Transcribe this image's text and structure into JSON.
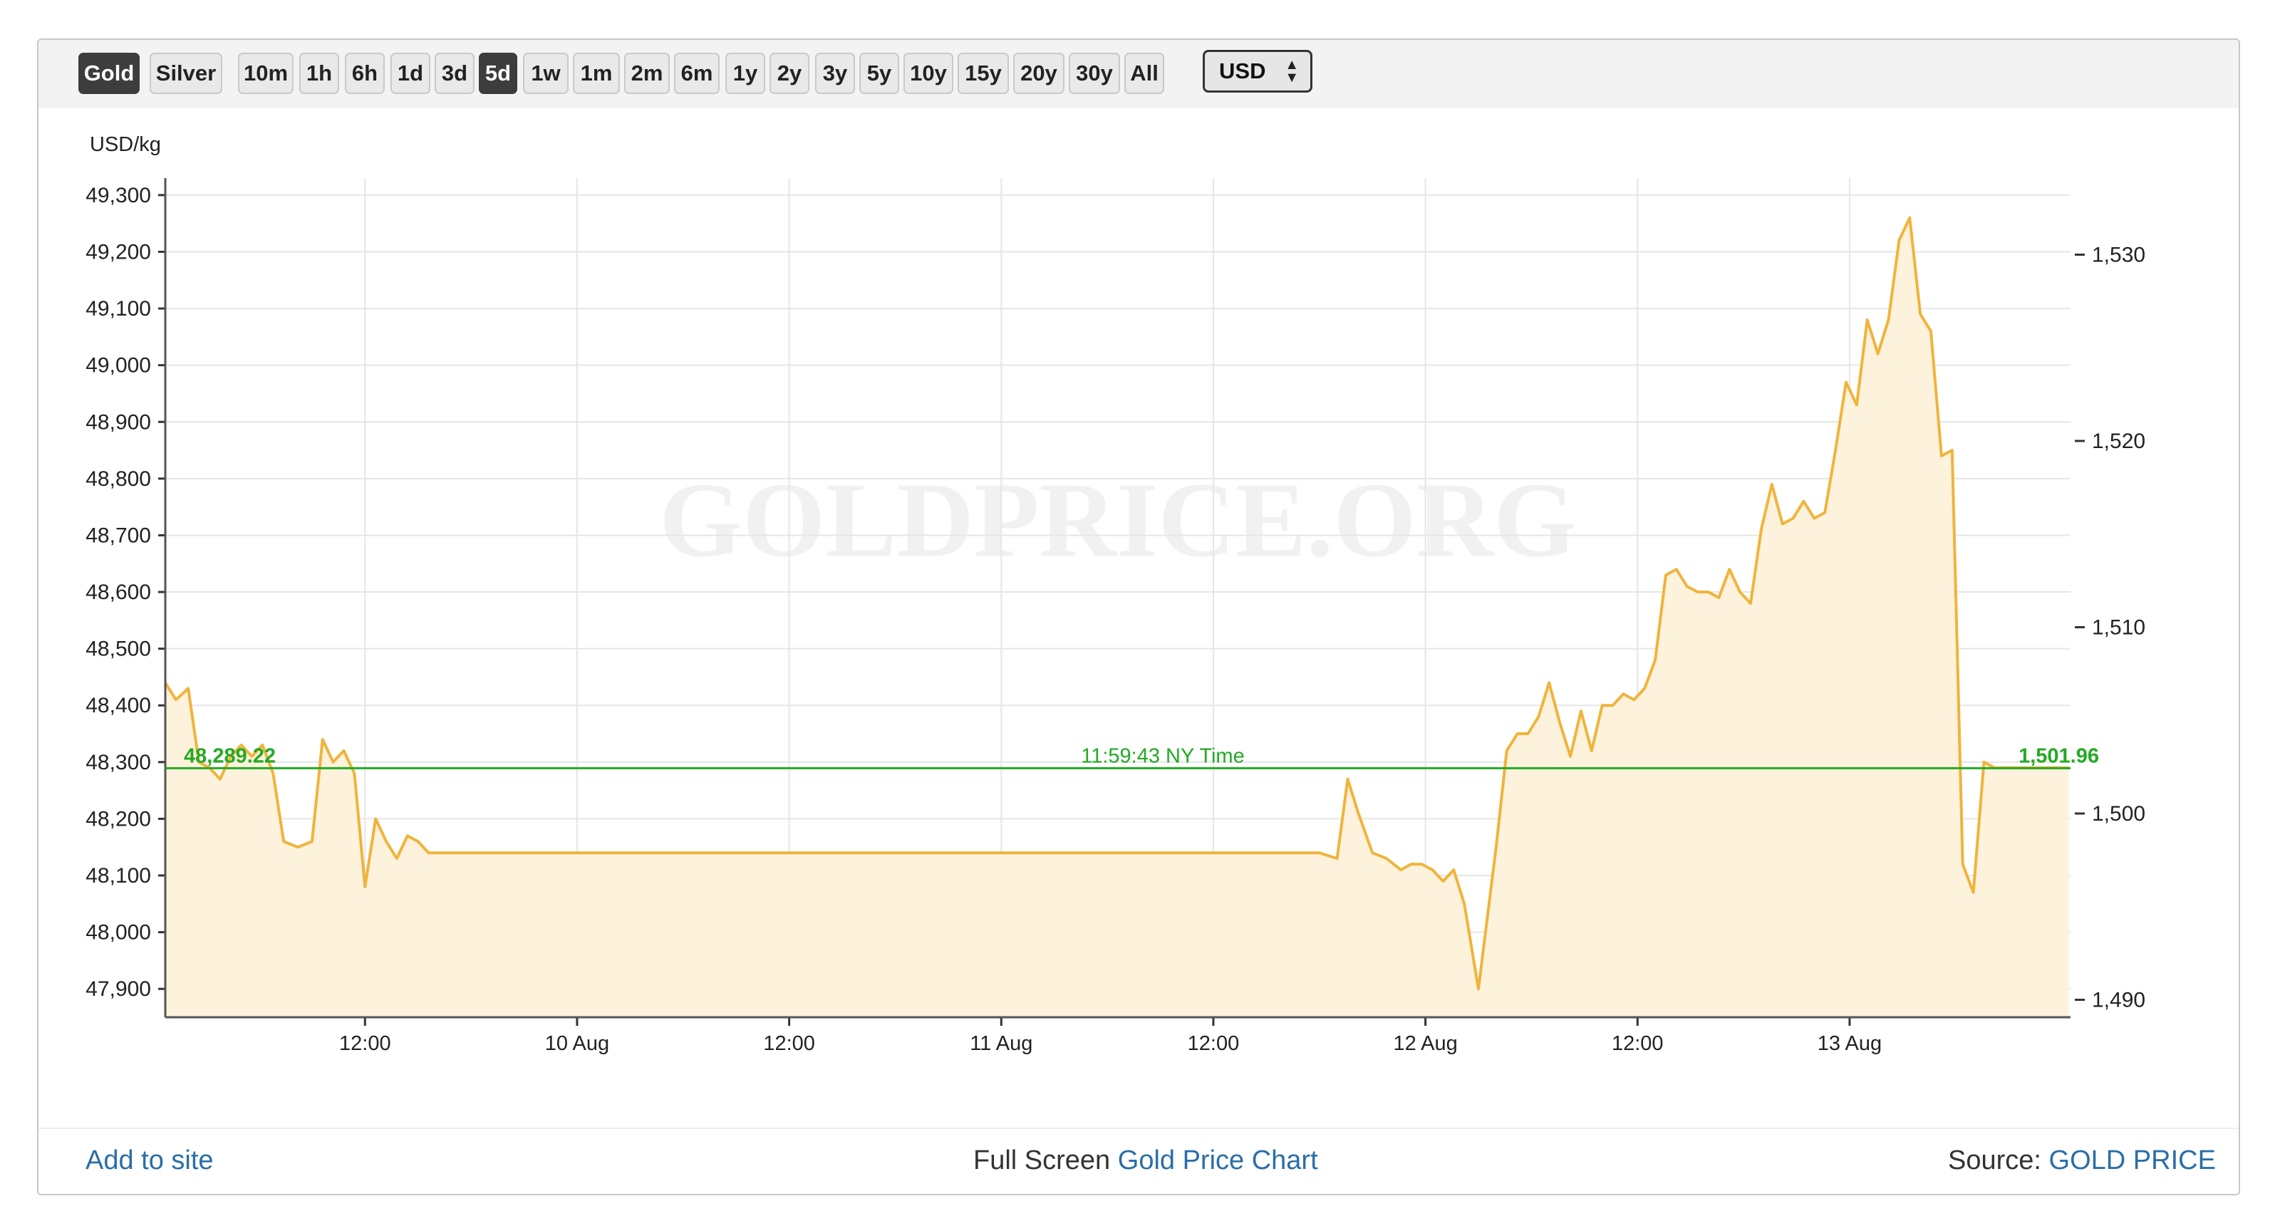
{
  "toolbar": {
    "metals": [
      {
        "label": "Gold",
        "active": true
      },
      {
        "label": "Silver",
        "active": false
      }
    ],
    "ranges": [
      {
        "label": "10m",
        "active": false
      },
      {
        "label": "1h",
        "active": false
      },
      {
        "label": "6h",
        "active": false
      },
      {
        "label": "1d",
        "active": false
      },
      {
        "label": "3d",
        "active": false
      },
      {
        "label": "5d",
        "active": true
      },
      {
        "label": "1w",
        "active": false
      },
      {
        "label": "1m",
        "active": false
      },
      {
        "label": "2m",
        "active": false
      },
      {
        "label": "6m",
        "active": false
      },
      {
        "label": "1y",
        "active": false
      },
      {
        "label": "2y",
        "active": false
      },
      {
        "label": "3y",
        "active": false
      },
      {
        "label": "5y",
        "active": false
      },
      {
        "label": "10y",
        "active": false
      },
      {
        "label": "15y",
        "active": false
      },
      {
        "label": "20y",
        "active": false
      },
      {
        "label": "30y",
        "active": false
      },
      {
        "label": "All",
        "active": false
      }
    ],
    "currency": "USD"
  },
  "watermark": "GOLDPRICE.ORG",
  "footer": {
    "add_to_site": "Add to site",
    "full_screen_prefix": "Full Screen",
    "full_screen_link": "Gold Price Chart",
    "source_prefix": "Source:",
    "source_link": "GOLD PRICE"
  },
  "colors": {
    "line": "#f0b43c",
    "fill": "#fdf2dc",
    "reference": "#22aa22",
    "grid": "#e6e6e6"
  },
  "chart_data": {
    "type": "area",
    "y_unit_label": "USD/kg",
    "ylim": [
      47850,
      49330
    ],
    "yticks": [
      47900,
      48000,
      48100,
      48200,
      48300,
      48400,
      48500,
      48600,
      48700,
      48800,
      48900,
      49000,
      49100,
      49200,
      49300
    ],
    "ytick_labels": [
      "47,900",
      "48,000",
      "48,100",
      "48,200",
      "48,300",
      "48,400",
      "48,500",
      "48,600",
      "48,700",
      "48,800",
      "48,900",
      "49,000",
      "49,100",
      "49,200",
      "49,300"
    ],
    "y2_ticks": [
      1490,
      1500,
      1510,
      1520,
      1530
    ],
    "y2_tick_labels": [
      "1,490",
      "1,500",
      "1,510",
      "1,520",
      "1,530"
    ],
    "x_tick_labels": [
      "12:00",
      "10 Aug",
      "12:00",
      "11 Aug",
      "12:00",
      "12 Aug",
      "12:00",
      "13 Aug"
    ],
    "x_tick_positions_hours": [
      12,
      24,
      36,
      48,
      60,
      72,
      84,
      96
    ],
    "xlim_hours": [
      0.7,
      108.5
    ],
    "grid": true,
    "reference": {
      "value": 48289.22,
      "left_label": "48,289.22",
      "center_label": "11:59:43 NY Time",
      "right_label": "1,501.96"
    },
    "series": [
      {
        "x": [
          0.7,
          1.3,
          2.0,
          2.6,
          3.2,
          3.8,
          4.4,
          5.0,
          5.6,
          6.2,
          6.8,
          7.4,
          8.2,
          9.0,
          9.6,
          10.2,
          10.8,
          11.4,
          12.0,
          12.6,
          13.2,
          13.8,
          14.4,
          15.0,
          15.6,
          16.2,
          17.0,
          17.6,
          18.4,
          19.0,
          20.0,
          30.0,
          40.0,
          50.0,
          60.0,
          66.0,
          67.0,
          67.6,
          68.2,
          69.0,
          69.8,
          70.6,
          71.2,
          71.8,
          72.4,
          73.0,
          73.6,
          74.2,
          75.0,
          76.0,
          76.6,
          77.2,
          77.8,
          78.4,
          79.0,
          79.6,
          80.2,
          80.8,
          81.4,
          82.0,
          82.6,
          83.2,
          83.8,
          84.4,
          85.0,
          85.6,
          86.2,
          86.8,
          87.4,
          88.0,
          88.6,
          89.2,
          89.8,
          90.4,
          91.0,
          91.6,
          92.2,
          92.8,
          93.4,
          94.0,
          94.6,
          95.2,
          95.8,
          96.4,
          97.0,
          97.6,
          98.2,
          98.8,
          99.4,
          100.0,
          100.6,
          101.2,
          101.8,
          102.4,
          103.0,
          103.6,
          104.2,
          104.8,
          105.4,
          106.0,
          106.6,
          107.2,
          107.8,
          108.4
        ],
        "y": [
          48440,
          48410,
          48430,
          48300,
          48290,
          48270,
          48310,
          48330,
          48310,
          48330,
          48280,
          48160,
          48150,
          48160,
          48340,
          48300,
          48320,
          48280,
          48080,
          48200,
          48160,
          48130,
          48170,
          48160,
          48140,
          48140,
          48140,
          48140,
          48140,
          48140,
          48140,
          48140,
          48140,
          48140,
          48140,
          48140,
          48130,
          48270,
          48210,
          48140,
          48130,
          48110,
          48120,
          48120,
          48110,
          48090,
          48110,
          48050,
          47900,
          48150,
          48320,
          48350,
          48350,
          48380,
          48440,
          48370,
          48310,
          48390,
          48320,
          48400,
          48400,
          48420,
          48410,
          48430,
          48480,
          48630,
          48640,
          48610,
          48600,
          48600,
          48590,
          48640,
          48600,
          48580,
          48710,
          48790,
          48720,
          48730,
          48760,
          48730,
          48740,
          48850,
          48970,
          48930,
          49080,
          49020,
          49080,
          49220,
          49260,
          49090,
          49060,
          48840,
          48850,
          48120,
          48070,
          48300,
          48290,
          48290,
          48290,
          48290,
          48290,
          48290,
          48290,
          48290
        ]
      }
    ]
  }
}
